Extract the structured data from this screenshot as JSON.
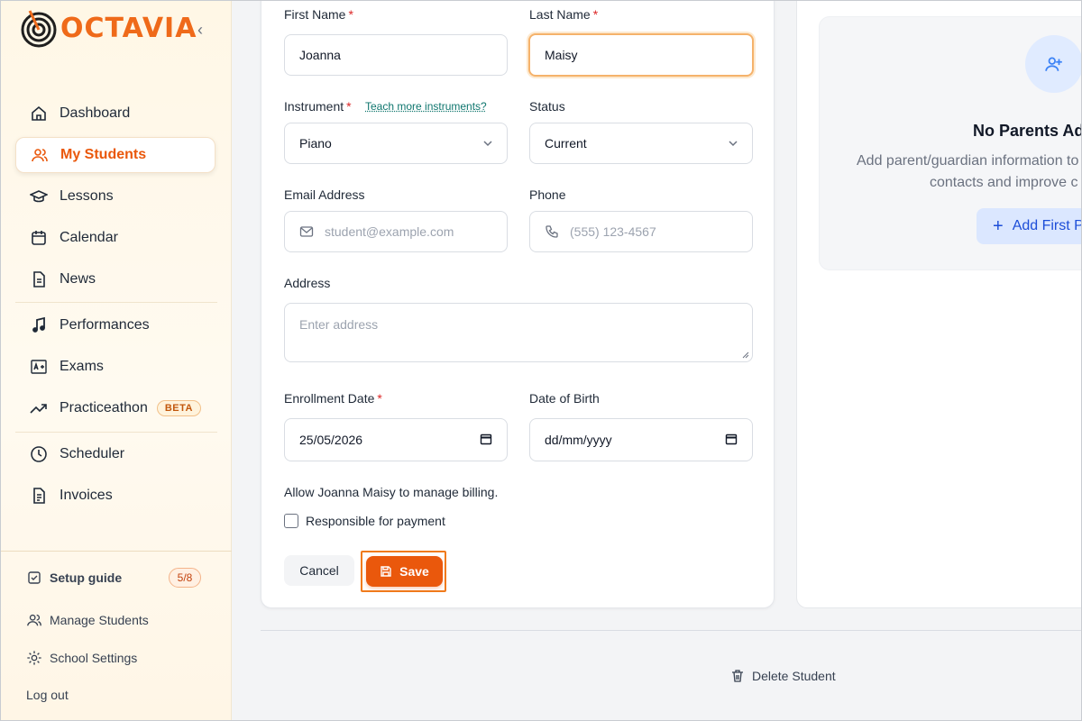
{
  "brand": {
    "name": "OCTAVIA",
    "accent": "#ea580c"
  },
  "sidebar": {
    "collapse_glyph": "‹",
    "items": [
      {
        "label": "Dashboard",
        "icon": "home-icon"
      },
      {
        "label": "My Students",
        "icon": "users-icon",
        "active": true
      },
      {
        "label": "Lessons",
        "icon": "graduation-cap-icon"
      },
      {
        "label": "Calendar",
        "icon": "calendar-icon"
      },
      {
        "label": "News",
        "icon": "document-icon"
      },
      {
        "label": "Performances",
        "icon": "music-note-icon"
      },
      {
        "label": "Exams",
        "icon": "grade-icon"
      },
      {
        "label": "Practiceathon",
        "icon": "trend-up-icon",
        "badge": "BETA"
      },
      {
        "label": "Scheduler",
        "icon": "clock-icon"
      },
      {
        "label": "Invoices",
        "icon": "invoice-icon"
      }
    ],
    "setup_guide": {
      "label": "Setup guide",
      "count": "5/8"
    },
    "manage_students": "Manage Students",
    "school_settings": "School Settings",
    "logout": "Log out"
  },
  "form": {
    "first_name": {
      "label": "First Name",
      "required": "*",
      "value": "Joanna"
    },
    "last_name": {
      "label": "Last Name",
      "required": "*",
      "value": "Maisy"
    },
    "instrument": {
      "label": "Instrument",
      "required": "*",
      "link": "Teach more instruments?",
      "value": "Piano"
    },
    "status": {
      "label": "Status",
      "value": "Current"
    },
    "email": {
      "label": "Email Address",
      "placeholder": "student@example.com"
    },
    "phone": {
      "label": "Phone",
      "placeholder": "(555) 123-4567"
    },
    "address": {
      "label": "Address",
      "placeholder": "Enter address"
    },
    "enrollment_date": {
      "label": "Enrollment Date",
      "required": "*",
      "value": "25/05/2026"
    },
    "date_of_birth": {
      "label": "Date of Birth",
      "value": "dd/mm/yyyy"
    },
    "billing_text": "Allow Joanna Maisy to manage billing.",
    "responsible_label": "Responsible for payment",
    "cancel_label": "Cancel",
    "save_label": "Save"
  },
  "parents": {
    "title": "No Parents Added",
    "desc_line1": "Add parent/guardian information to",
    "desc_line2": "contacts and improve c",
    "add_button": "Add First Parent",
    "add_glyph": "+"
  },
  "footer": {
    "delete_label": "Delete Student"
  }
}
